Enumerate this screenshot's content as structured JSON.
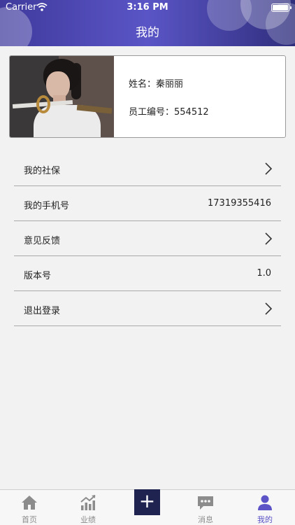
{
  "status_bar": {
    "carrier": "Carrier",
    "time": "3:16 PM"
  },
  "header": {
    "title": "我的"
  },
  "profile": {
    "name_text": "姓名：秦丽丽",
    "employee_id_text": "员工编号：554512"
  },
  "menu": [
    {
      "label": "我的社保",
      "value": "",
      "chevron": true
    },
    {
      "label": "我的手机号",
      "value": "17319355416",
      "chevron": false
    },
    {
      "label": "意见反馈",
      "value": "",
      "chevron": true
    },
    {
      "label": "版本号",
      "value": "1.0",
      "chevron": false
    },
    {
      "label": "退出登录",
      "value": "",
      "chevron": true
    }
  ],
  "tabs": [
    {
      "label": "首页",
      "icon": "home-icon"
    },
    {
      "label": "业绩",
      "icon": "chart-icon"
    },
    {
      "label": "消息",
      "icon": "message-icon"
    },
    {
      "label": "我的",
      "icon": "user-icon",
      "active": true
    }
  ],
  "add_button_symbol": "+",
  "colors": {
    "header_start": "#3f3a9c",
    "header_end": "#2f2e7c",
    "accent": "#5b53c6",
    "add_button": "#1f2350"
  }
}
